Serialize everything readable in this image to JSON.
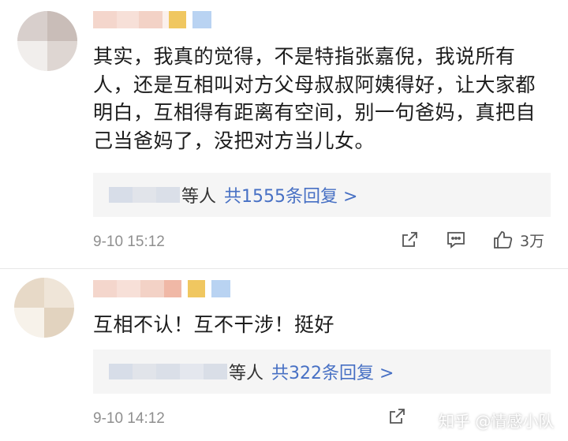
{
  "comments": [
    {
      "text": "其实，我真的觉得，不是特指张嘉倪，我说所有人，还是互相叫对方父母叔叔阿姨得好，让大家都明白，互相得有距离有空间，别一句爸妈，真把自己当爸妈了，没把对方当儿女。",
      "lines": [
        "其实，我真的觉得，不是特指张嘉倪，我说所有",
        "人，还是互相叫对方父母叔叔阿姨得好，让大家都",
        "明白，互相得有距离有空间，别一句爸妈，真把自",
        "己当爸妈了，没把对方当儿女。"
      ],
      "reply_suffix": "等人",
      "reply_count_label": "共1555条回复 >",
      "time": "9-10 15:12",
      "like_count": "3万"
    },
    {
      "lines": [
        "互相不认！互不干涉！挺好"
      ],
      "reply_suffix": "等人",
      "reply_count_label": "共322条回复 >",
      "time": "9-10 14:12"
    }
  ],
  "watermark": "知乎 @情感小队",
  "icons": [
    "share-icon",
    "comment-icon",
    "like-icon"
  ],
  "colors": {
    "link": "#4770c4",
    "meta": "#8f8f8f",
    "reply_bg": "#f5f5f5"
  }
}
